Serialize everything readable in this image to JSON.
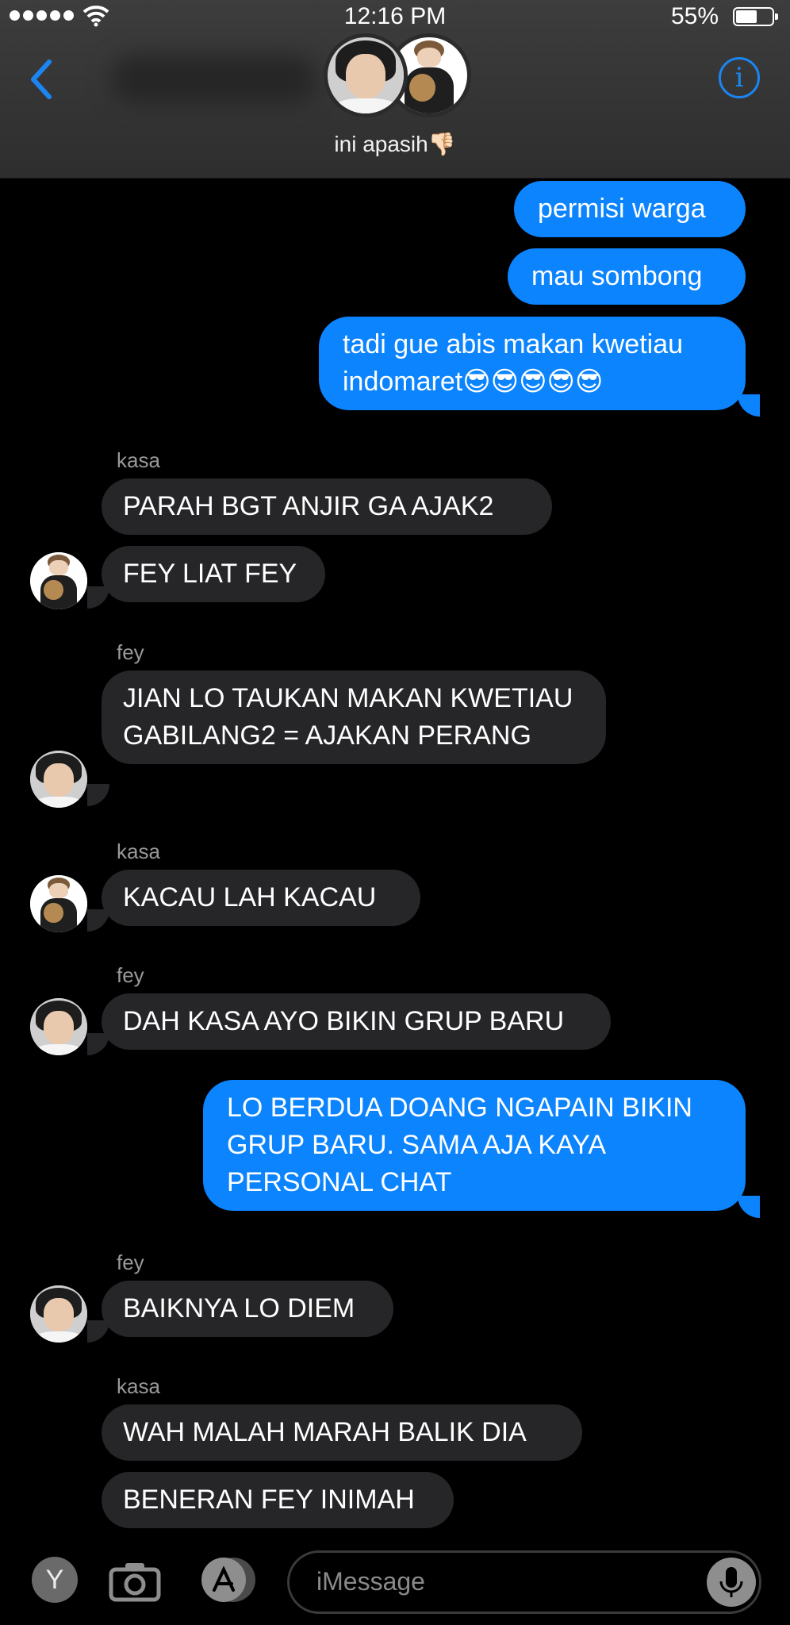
{
  "status_bar": {
    "time": "12:16 PM",
    "battery_percent": "55%",
    "battery_level": 0.55
  },
  "header": {
    "group_name": "ini apasih👎🏻",
    "back_icon": "chevron-left-icon",
    "info_icon": "info-icon",
    "accent_color": "#1b86f3"
  },
  "messages": [
    {
      "from": "me",
      "text": "permisi warga"
    },
    {
      "from": "me",
      "text": "mau sombong"
    },
    {
      "from": "me",
      "text": "tadi gue abis makan kwetiau indomaret😎😎😎😎😎"
    },
    {
      "sender_label": "kasa"
    },
    {
      "from": "kasa",
      "text": "PARAH BGT ANJIR GA AJAK2"
    },
    {
      "from": "kasa",
      "text": "FEY LIAT FEY"
    },
    {
      "sender_label": "fey"
    },
    {
      "from": "fey",
      "text": "JIAN LO TAUKAN MAKAN KWETIAU GABILANG2 = AJAKAN PERANG"
    },
    {
      "sender_label": "kasa"
    },
    {
      "from": "kasa",
      "text": "KACAU LAH KACAU"
    },
    {
      "sender_label": "fey"
    },
    {
      "from": "fey",
      "text": "DAH KASA AYO BIKIN GRUP BARU"
    },
    {
      "from": "me",
      "text": "LO BERDUA DOANG NGAPAIN BIKIN GRUP BARU. SAMA AJA KAYA PERSONAL CHAT"
    },
    {
      "sender_label": "fey"
    },
    {
      "from": "fey",
      "text": "BAIKNYA LO DIEM"
    },
    {
      "sender_label": "kasa"
    },
    {
      "from": "kasa",
      "text": "WAH MALAH MARAH BALIK DIA"
    },
    {
      "from": "kasa",
      "text": "BENERAN FEY INIMAH"
    }
  ],
  "input_bar": {
    "placeholder": "iMessage",
    "y_app_label": "Y",
    "camera_icon": "camera-icon",
    "appstore_icon": "app-store-icon",
    "mic_icon": "microphone-icon"
  },
  "colors": {
    "sent_bubble": "#0b84fe",
    "received_bubble": "#262628",
    "background": "#000000"
  }
}
